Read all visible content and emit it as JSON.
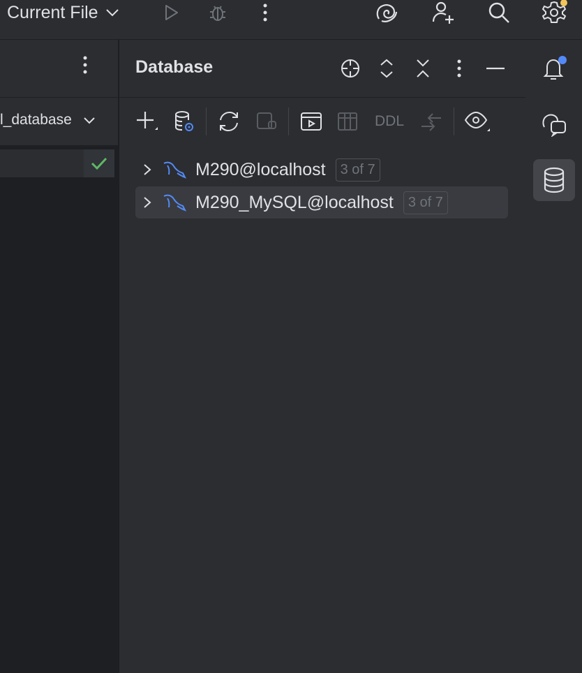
{
  "toolbar": {
    "run_config_label": "Current File"
  },
  "editor": {
    "schema_label": "l_database"
  },
  "database_panel": {
    "title": "Database",
    "ddl_label": "DDL",
    "connections": [
      {
        "name": "M290@localhost",
        "badge": "3 of 7",
        "selected": false
      },
      {
        "name": "M290_MySQL@localhost",
        "badge": "3 of 7",
        "selected": true
      }
    ]
  },
  "colors": {
    "background": "#2b2d30",
    "editor_background": "#1e1f22",
    "accent_blue": "#548af7",
    "notification_dot": "#f2c55c",
    "check_green": "#5fb865",
    "text": "#dfe1e5",
    "muted": "#6f737a"
  },
  "icons": [
    "chevron-down-icon",
    "run-icon",
    "debug-icon",
    "more-vertical-icon",
    "ai-assistant-icon",
    "add-user-icon",
    "search-icon",
    "settings-icon",
    "locate-icon",
    "expand-all-icon",
    "collapse-all-icon",
    "minimize-icon",
    "add-icon",
    "data-source-properties-icon",
    "refresh-icon",
    "disconnect-icon",
    "jump-to-console-icon",
    "table-view-icon",
    "compare-icon",
    "view-options-icon",
    "chevron-right-icon",
    "mysql-icon",
    "notifications-icon",
    "ai-chat-icon",
    "database-icon",
    "check-icon"
  ]
}
